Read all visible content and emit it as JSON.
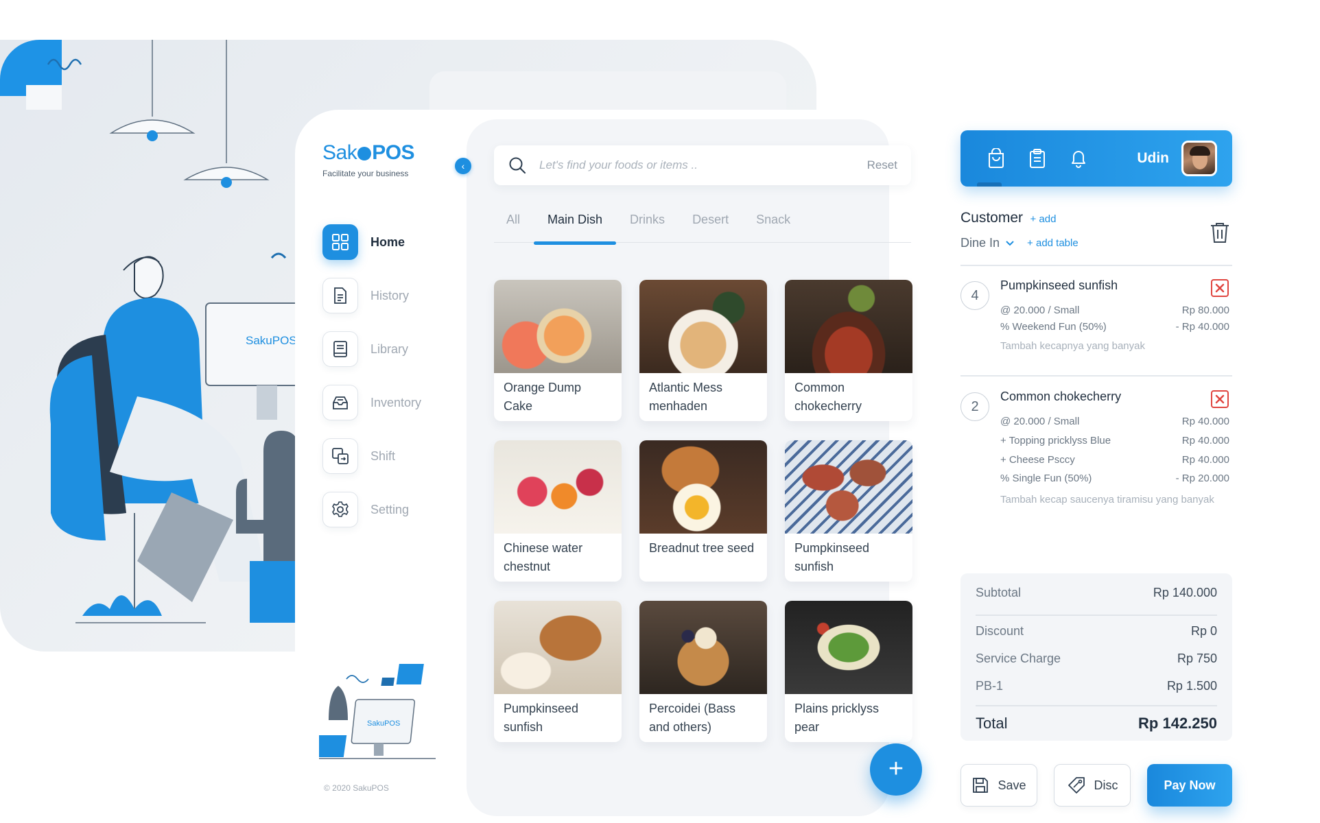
{
  "brand": {
    "logo_part1": "Sak",
    "logo_part2": "POS",
    "tagline": "Facilitate your business",
    "copyright": "© 2020 SakuPOS",
    "illustration_monitor_text": "SakuPOS"
  },
  "nav": {
    "items": [
      {
        "label": "Home",
        "icon": "grid-icon",
        "active": true
      },
      {
        "label": "History",
        "icon": "document-icon",
        "active": false
      },
      {
        "label": "Library",
        "icon": "book-icon",
        "active": false
      },
      {
        "label": "Inventory",
        "icon": "inbox-icon",
        "active": false
      },
      {
        "label": "Shift",
        "icon": "shift-icon",
        "active": false
      },
      {
        "label": "Setting",
        "icon": "gear-icon",
        "active": false
      }
    ]
  },
  "search": {
    "placeholder": "Let's find your foods or items ..",
    "value": "",
    "reset_label": "Reset"
  },
  "categories": {
    "tabs": [
      "All",
      "Main Dish",
      "Drinks",
      "Desert",
      "Snack"
    ],
    "active": "Main Dish"
  },
  "menu": {
    "items": [
      {
        "name": "Orange Dump Cake"
      },
      {
        "name": "Atlantic Mess menhaden"
      },
      {
        "name": "Common chokecherry"
      },
      {
        "name": "Chinese water chestnut"
      },
      {
        "name": "Breadnut tree seed"
      },
      {
        "name": "Pumpkinseed sunfish"
      },
      {
        "name": "Pumpkinseed sunfish"
      },
      {
        "name": "Percoidei (Bass and others)"
      },
      {
        "name": "Plains pricklyss pear"
      }
    ],
    "add_button": "+"
  },
  "topbar": {
    "icons": [
      "shopping-bag-icon",
      "clipboard-icon",
      "bell-icon"
    ],
    "user_name": "Udin"
  },
  "order": {
    "customer_label": "Customer",
    "add_customer": "+ add",
    "dine_option": "Dine In",
    "add_table": "+ add table",
    "items": [
      {
        "qty": "4",
        "name": "Pumpkinseed sunfish",
        "lines": [
          {
            "label": "@ 20.000  /  Small",
            "value": "Rp 80.000"
          },
          {
            "label": "% Weekend Fun (50%)",
            "value": "- Rp 40.000"
          }
        ],
        "note": "Tambah kecapnya yang banyak"
      },
      {
        "qty": "2",
        "name": "Common chokecherry",
        "lines": [
          {
            "label": "@ 20.000  /  Small",
            "value": "Rp 40.000"
          },
          {
            "label": "+ Topping pricklyss Blue",
            "value": "Rp 40.000"
          },
          {
            "label": "+ Cheese Psccy",
            "value": "Rp 40.000"
          },
          {
            "label": "% Single Fun (50%)",
            "value": "- Rp 20.000"
          }
        ],
        "note": "Tambah kecap saucenya tiramisu yang banyak"
      }
    ]
  },
  "summary": {
    "subtotal_label": "Subtotal",
    "subtotal": "Rp 140.000",
    "discount_label": "Discount",
    "discount": "Rp 0",
    "service_label": "Service Charge",
    "service": "Rp 750",
    "tax_label": "PB-1",
    "tax": "Rp 1.500",
    "total_label": "Total",
    "total": "Rp 142.250"
  },
  "actions": {
    "save": "Save",
    "disc": "Disc",
    "pay": "Pay Now"
  },
  "colors": {
    "accent": "#1e8fe0",
    "panel_bg": "#f3f5f8",
    "danger": "#e0453f"
  }
}
